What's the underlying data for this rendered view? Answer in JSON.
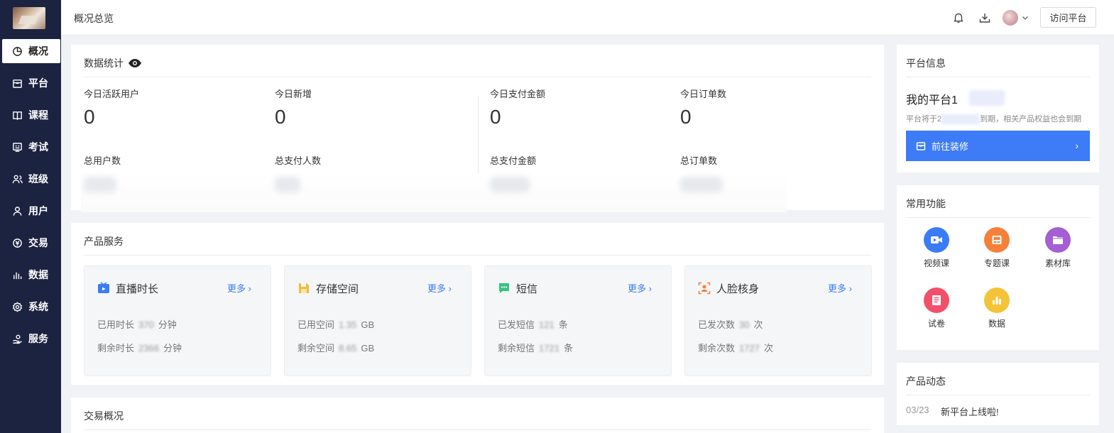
{
  "sidebar": {
    "items": [
      {
        "label": "概况",
        "icon": "pie-chart-icon"
      },
      {
        "label": "平台",
        "icon": "storefront-icon"
      },
      {
        "label": "课程",
        "icon": "book-icon"
      },
      {
        "label": "考试",
        "icon": "exam-icon"
      },
      {
        "label": "班级",
        "icon": "class-icon"
      },
      {
        "label": "用户",
        "icon": "user-icon"
      },
      {
        "label": "交易",
        "icon": "transaction-icon"
      },
      {
        "label": "数据",
        "icon": "bar-chart-icon"
      },
      {
        "label": "系统",
        "icon": "gear-icon"
      },
      {
        "label": "服务",
        "icon": "service-icon"
      }
    ]
  },
  "header": {
    "title": "概况总览",
    "visit_label": "访问平台"
  },
  "stats": {
    "title": "数据统计",
    "today": [
      {
        "label": "今日活跃用户",
        "value": "0"
      },
      {
        "label": "今日新增",
        "value": "0"
      },
      {
        "label": "今日支付金额",
        "value": "0"
      },
      {
        "label": "今日订单数",
        "value": "0"
      }
    ],
    "totals": [
      {
        "label": "总用户数"
      },
      {
        "label": "总支付人数"
      },
      {
        "label": "总支付金额"
      },
      {
        "label": "总订单数"
      }
    ]
  },
  "products": {
    "title": "产品服务",
    "more_label": "更多 ›",
    "cards": [
      {
        "title": "直播时长",
        "color": "#3a7cf5",
        "row1_label": "已用时长",
        "row1_value": "370",
        "row1_unit": "分钟",
        "row2_label": "剩余时长",
        "row2_value": "2366",
        "row2_unit": "分钟"
      },
      {
        "title": "存储空间",
        "color": "#f5b935",
        "row1_label": "已用空间",
        "row1_value": "1.35",
        "row1_unit": "GB",
        "row2_label": "剩余空间",
        "row2_value": "8.65",
        "row2_unit": "GB"
      },
      {
        "title": "短信",
        "color": "#36c37c",
        "row1_label": "已发短信",
        "row1_value": "121",
        "row1_unit": "条",
        "row2_label": "剩余短信",
        "row2_value": "1721",
        "row2_unit": "条"
      },
      {
        "title": "人脸核身",
        "color": "#f5803a",
        "row1_label": "已发次数",
        "row1_value": "30",
        "row1_unit": "次",
        "row2_label": "剩余次数",
        "row2_value": "1727",
        "row2_unit": "次"
      }
    ]
  },
  "trade": {
    "title": "交易概况"
  },
  "platform": {
    "title": "平台信息",
    "name": "我的平台1",
    "expire_prefix": "平台将于2",
    "expire_suffix": "到期，相关产品权益也会到期",
    "decorate_label": "前往装修",
    "decorate_arrow": "›"
  },
  "functions": {
    "title": "常用功能",
    "items": [
      {
        "label": "视频课",
        "color": "#3a7cf5"
      },
      {
        "label": "专题课",
        "color": "#f5803a"
      },
      {
        "label": "素材库",
        "color": "#a35fd3"
      },
      {
        "label": "试卷",
        "color": "#f2506a"
      },
      {
        "label": "数据",
        "color": "#f5c338"
      }
    ]
  },
  "news": {
    "title": "产品动态",
    "items": [
      {
        "date": "03/23",
        "text": "新平台上线啦!"
      }
    ]
  }
}
